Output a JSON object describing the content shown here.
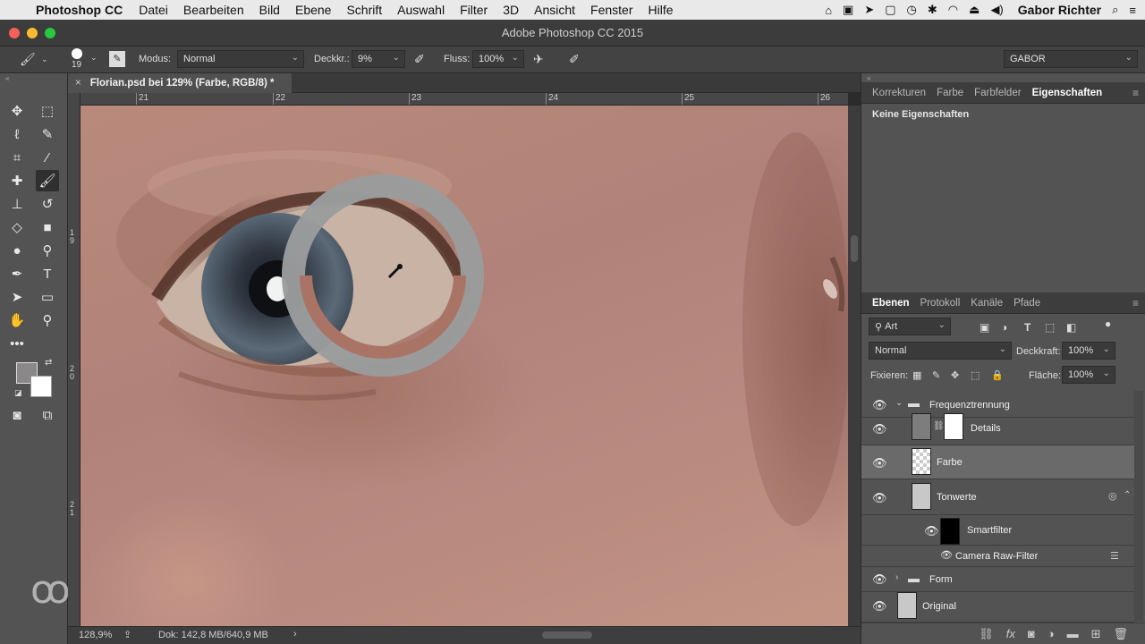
{
  "menubar": {
    "app_name": "Photoshop CC",
    "menus": [
      "Datei",
      "Bearbeiten",
      "Bild",
      "Ebene",
      "Schrift",
      "Auswahl",
      "Filter",
      "3D",
      "Ansicht",
      "Fenster",
      "Hilfe"
    ],
    "user": "Gabor Richter"
  },
  "window": {
    "title": "Adobe Photoshop CC 2015"
  },
  "options": {
    "brush_size": "19",
    "mode_label": "Modus:",
    "mode_value": "Normal",
    "opacity_label": "Deckkr.:",
    "opacity_value": "9%",
    "flow_label": "Fluss:",
    "flow_value": "100%",
    "workspace": "GABOR"
  },
  "document": {
    "tab_title": "Florian.psd bei 129% (Farbe, RGB/8) *"
  },
  "rulers": {
    "h_labels": [
      "21",
      "22",
      "23",
      "24",
      "25",
      "26"
    ],
    "v_labels": [
      "1 9",
      "2 0",
      "2 1"
    ]
  },
  "status": {
    "zoom": "128,9%",
    "doc_info": "Dok: 142,8 MB/640,9 MB"
  },
  "properties": {
    "tabs": [
      "Korrekturen",
      "Farbe",
      "Farbfelder",
      "Eigenschaften"
    ],
    "active_tab": "Eigenschaften",
    "empty_text": "Keine Eigenschaften"
  },
  "layers_panel": {
    "tabs": [
      "Ebenen",
      "Protokoll",
      "Kanäle",
      "Pfade"
    ],
    "active_tab": "Ebenen",
    "filter_value": "Art",
    "blend_mode": "Normal",
    "opacity_label": "Deckkraft:",
    "opacity_value": "100%",
    "lock_label": "Fixieren:",
    "fill_label": "Fläche:",
    "fill_value": "100%",
    "layers": [
      {
        "name": "Frequenztrennung",
        "type": "group"
      },
      {
        "name": "Details",
        "type": "layer"
      },
      {
        "name": "Farbe",
        "type": "layer",
        "selected": true
      },
      {
        "name": "Tonwerte",
        "type": "smart"
      },
      {
        "name": "Smartfilter",
        "type": "filter-mask"
      },
      {
        "name": "Camera Raw-Filter",
        "type": "filter"
      },
      {
        "name": "Form",
        "type": "group"
      },
      {
        "name": "Original",
        "type": "smart"
      }
    ]
  },
  "colors": {
    "selected_layer": "#6a6a6a",
    "panel_bg": "#535353",
    "canvas_skin": "#b98a7b"
  }
}
